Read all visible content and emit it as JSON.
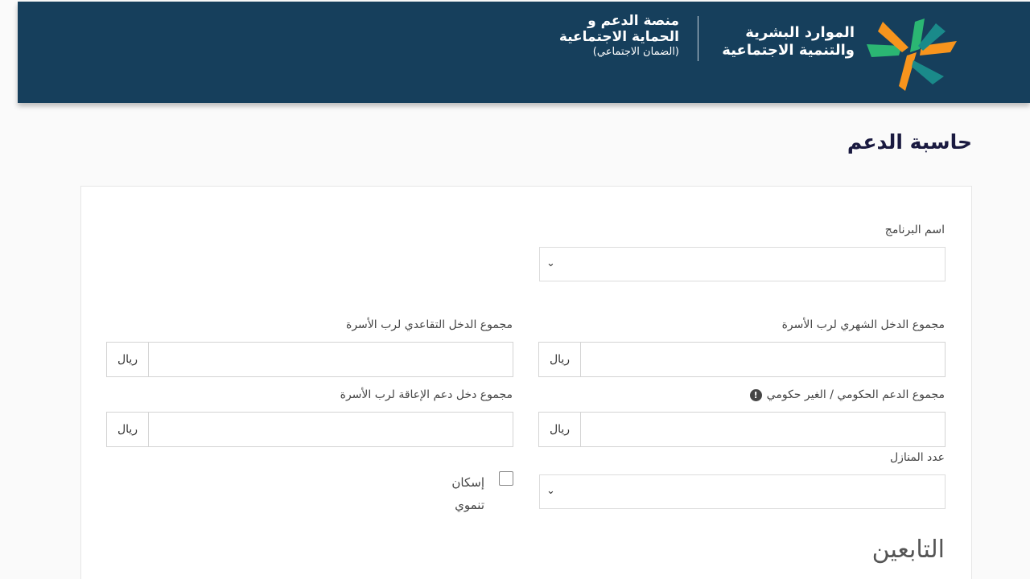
{
  "header": {
    "ministry_line1": "الموارد البشرية",
    "ministry_line2": "والتنمية الاجتماعية",
    "platform_line1": "منصة الدعم و",
    "platform_line2": "الحماية الاجتماعية",
    "platform_line3": "(الضمان الاجتماعي)",
    "colors": {
      "bar": "#163f5c",
      "logo_green": "#2bb673",
      "logo_orange": "#f7941d",
      "logo_teal": "#1a8a8a"
    }
  },
  "page_title": "حاسبة الدعم",
  "form": {
    "program_name": {
      "label": "اسم البرنامج",
      "value": ""
    },
    "monthly_income": {
      "label": "مجموع الدخل الشهري لرب الأسرة",
      "currency": "ريال",
      "value": ""
    },
    "retirement_income": {
      "label": "مجموع الدخل التقاعدي لرب الأسرة",
      "currency": "ريال",
      "value": ""
    },
    "gov_support": {
      "label": "مجموع الدعم الحكومي / الغير حكومي",
      "currency": "ريال",
      "value": ""
    },
    "disability_income": {
      "label": "مجموع دخل دعم الإعاقة لرب الأسرة",
      "currency": "ريال",
      "value": ""
    },
    "houses_count": {
      "label": "عدد المنازل",
      "value": ""
    },
    "dev_housing": {
      "label_line1": "إسكان",
      "label_line2": "تنموي",
      "checked": false
    }
  },
  "dependents_title": "التابعين"
}
